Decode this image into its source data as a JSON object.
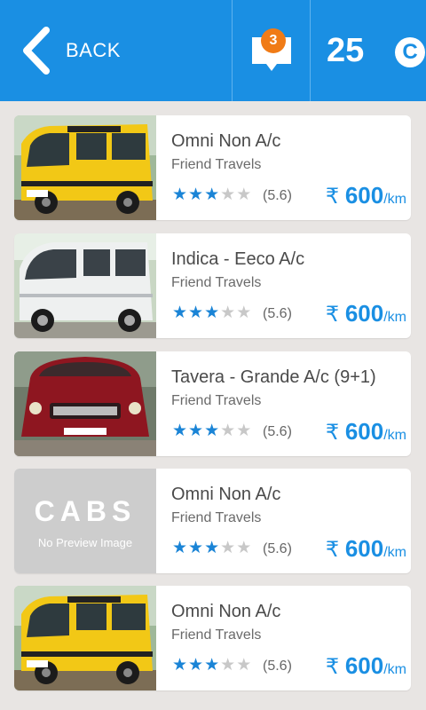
{
  "header": {
    "back_label": "BACK",
    "notification_count": "3",
    "credits": "25",
    "credit_symbol": "C"
  },
  "colors": {
    "brand": "#1a8fe3",
    "badge": "#f07b16",
    "star_on": "#1a84d6",
    "star_off": "#c8c8c8"
  },
  "cabs": [
    {
      "title": "Omni Non A/c",
      "company": "Friend Travels",
      "rating": "(5.6)",
      "stars_filled": 3,
      "stars_total": 5,
      "currency": "₹",
      "price": "600",
      "unit": "/km",
      "image": "yellow-van-photo"
    },
    {
      "title": "Indica - Eeco A/c",
      "company": "Friend Travels",
      "rating": "(5.6)",
      "stars_filled": 3,
      "stars_total": 5,
      "currency": "₹",
      "price": "600",
      "unit": "/km",
      "image": "white-van-photo"
    },
    {
      "title": "Tavera - Grande A/c (9+1)",
      "company": "Friend Travels",
      "rating": "(5.6)",
      "stars_filled": 3,
      "stars_total": 5,
      "currency": "₹",
      "price": "600",
      "unit": "/km",
      "image": "red-suv-photo"
    },
    {
      "title": "Omni Non A/c",
      "company": "Friend Travels",
      "rating": "(5.6)",
      "stars_filled": 3,
      "stars_total": 5,
      "currency": "₹",
      "price": "600",
      "unit": "/km",
      "image": "no-preview",
      "placeholder_text": "No Preview Image",
      "placeholder_logo": "CABS"
    },
    {
      "title": "Omni Non A/c",
      "company": "Friend Travels",
      "rating": "(5.6)",
      "stars_filled": 3,
      "stars_total": 5,
      "currency": "₹",
      "price": "600",
      "unit": "/km",
      "image": "yellow-van-photo"
    }
  ]
}
